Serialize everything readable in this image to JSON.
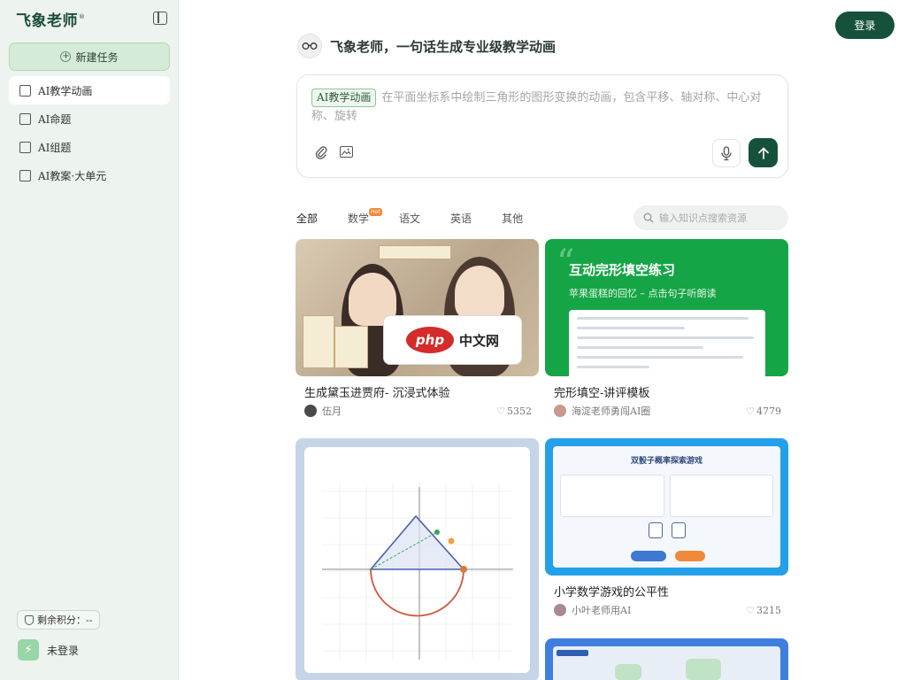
{
  "sidebar": {
    "logo": "飞象老师",
    "logo_mark": "®",
    "new_task": "新建任务",
    "items": [
      {
        "label": "AI教学动画",
        "active": true
      },
      {
        "label": "AI命题",
        "active": false
      },
      {
        "label": "AI组题",
        "active": false
      },
      {
        "label": "AI教案·大单元",
        "active": false
      }
    ],
    "credits": "剩余积分：--",
    "user": "未登录"
  },
  "header": {
    "login": "登录",
    "brand_title": "飞象老师，一句话生成专业级教学动画"
  },
  "prompt": {
    "tag": "AI教学动画",
    "placeholder": "在平面坐标系中绘制三角形的图形变换的动画，包含平移、轴对称、中心对称、旋转"
  },
  "tabs": [
    {
      "label": "全部",
      "active": true
    },
    {
      "label": "数学",
      "badge": "Hot"
    },
    {
      "label": "语文"
    },
    {
      "label": "英语"
    },
    {
      "label": "其他"
    }
  ],
  "search": {
    "placeholder": "输入知识点搜索资源"
  },
  "cards": [
    {
      "title": "生成黛玉进贾府- 沉浸式体验",
      "author": "伍月",
      "likes": "5352",
      "thumb_text": "php 中文网"
    },
    {
      "title": "完形填空-讲评模板",
      "author": "海淀老师勇闯AI圈",
      "likes": "4779",
      "thumb_title": "互动完形填空练习",
      "thumb_sub": "苹果蛋糕的回忆 – 点击句子听朗读"
    },
    {
      "title": "",
      "author": "",
      "likes": ""
    },
    {
      "title": "小学数学游戏的公平性",
      "author": "小叶老师用AI",
      "likes": "3215",
      "thumb_title": "双骰子概率探索游戏"
    }
  ],
  "colors": {
    "primary": "#16523b",
    "sidebar_bg": "#edf3ee",
    "green_card": "#16a546",
    "blue_card": "#23a0ea"
  }
}
